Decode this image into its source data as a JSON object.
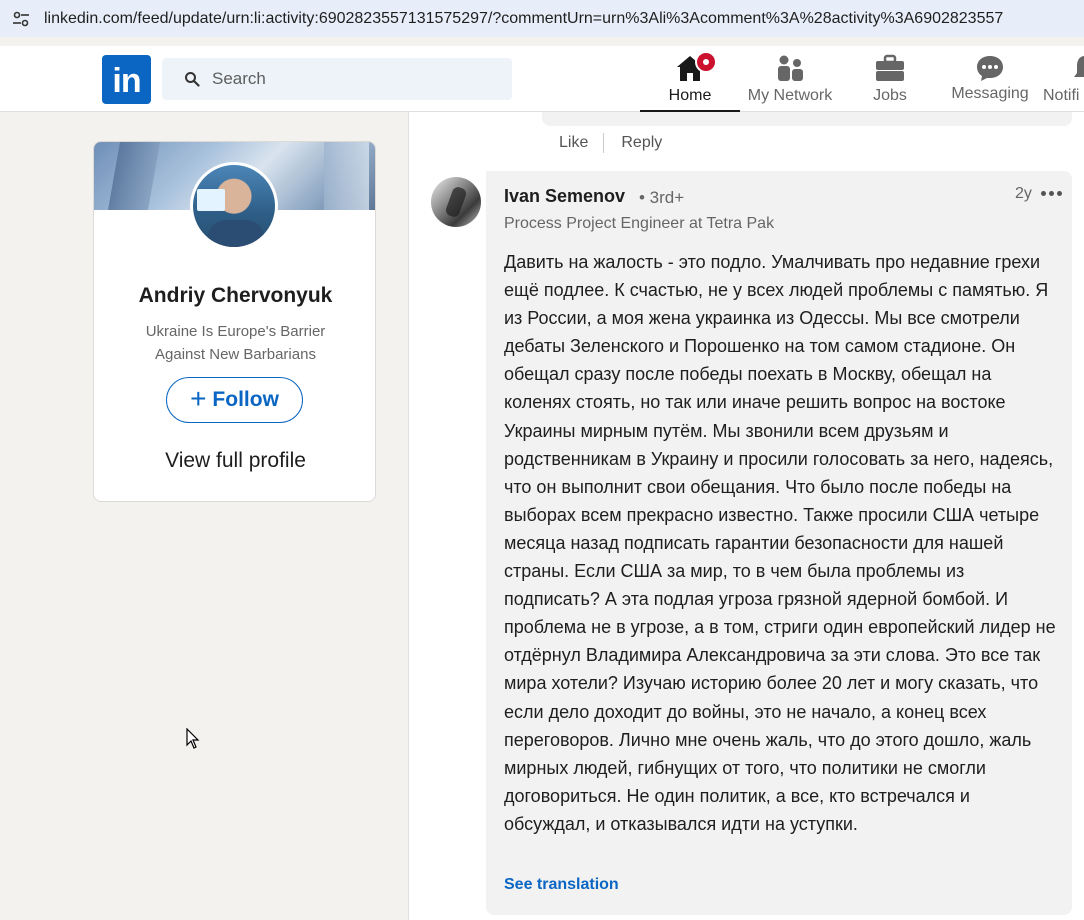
{
  "browser": {
    "url": "linkedin.com/feed/update/urn:li:activity:6902823557131575297/?commentUrn=urn%3Ali%3Acomment%3A%28activity%3A6902823557"
  },
  "nav": {
    "search_placeholder": "Search",
    "items": [
      {
        "label": "Home",
        "icon": "home-icon",
        "active": true
      },
      {
        "label": "My Network",
        "icon": "network-icon"
      },
      {
        "label": "Jobs",
        "icon": "briefcase-icon"
      },
      {
        "label": "Messaging",
        "icon": "messaging-icon"
      },
      {
        "label": "Notifi",
        "icon": "bell-icon"
      }
    ]
  },
  "profile": {
    "name": "Andriy Chervonyuk",
    "headline": "Ukraine Is Europe's Barrier Against New Barbarians",
    "follow_label": "Follow",
    "view_profile_label": "View full profile"
  },
  "previous_comment": {
    "like_label": "Like",
    "reply_label": "Reply"
  },
  "comment": {
    "author": "Ivan Semenov",
    "degree": "• 3rd+",
    "title": "Process Project Engineer at Tetra Pak",
    "time": "2y",
    "text": "Давить на жалость - это подло. Умалчивать про недавние грехи ещё подлее. К счастью, не у всех людей проблемы с памятью. Я из России, а моя жена украинка из Одессы. Мы все смотрели дебаты Зеленского и Порошенко на том самом стадионе. Он обещал сразу после победы поехать в Москву, обещал на коленях стоять, но так или иначе решить вопрос на востоке Украины мирным путём. Мы звонили всем друзьям и родственникам в Украину и просили голосовать за него, надеясь, что он выполнит свои обещания. Что было после победы на выборах всем прекрасно известно. Также просили США четыре месяца назад подписать гарантии безопасности для нашей страны. Если США за мир, то в чем была проблемы из подписать? А эта подлая угроза грязной ядерной бомбой. И проблема не в угрозе, а в том, стриги один европейский лидер не отдёрнул Владимира Александровича за эти слова. Это все так мира хотели? Изучаю историю более 20 лет и могу сказать, что если дело доходит до войны, это не начало, а конец всех переговоров. Лично мне очень жаль, что до этого дошло, жаль мирных людей, гибнущих от того, что политики не смогли договориться. Не один политик, а все, кто встречался и обсуждал, и отказывался идти на уступки.",
    "translate_label": "See translation"
  },
  "colors": {
    "brand": "#0a66c2",
    "notification": "#cb112d",
    "page_bg": "#f4f2ee",
    "bubble_bg": "#f2f2f2"
  }
}
